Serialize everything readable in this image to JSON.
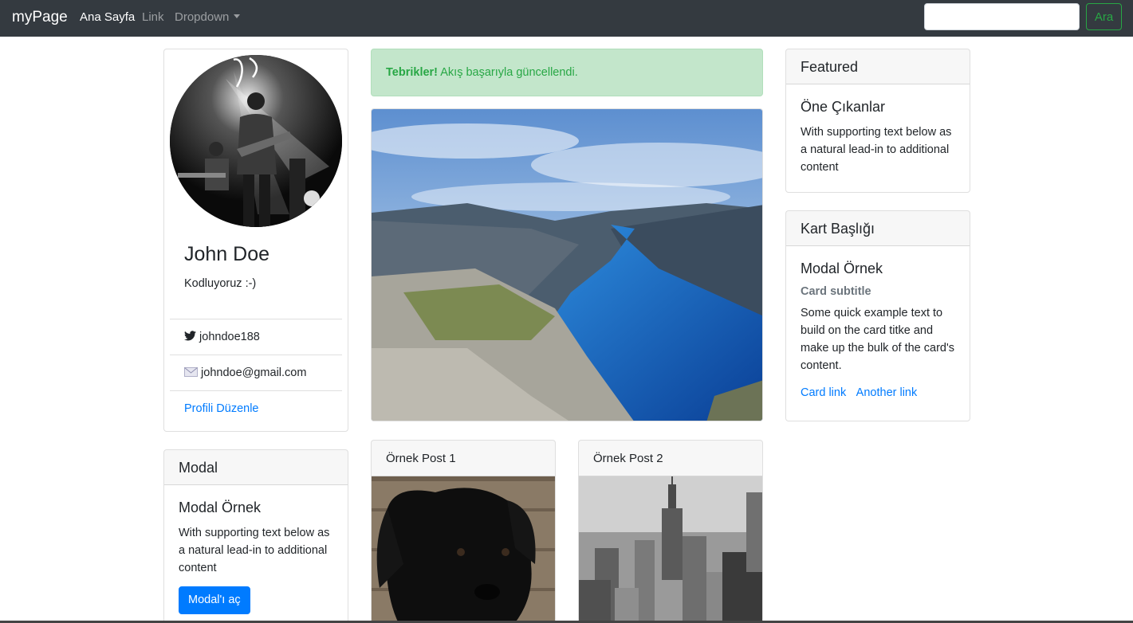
{
  "navbar": {
    "brand": "myPage",
    "links": [
      {
        "label": "Ana Sayfa",
        "active": true
      },
      {
        "label": "Link",
        "active": false
      },
      {
        "label": "Dropdown",
        "active": false
      }
    ],
    "search_placeholder": "",
    "search_button": "Ara"
  },
  "profile": {
    "name": "John Doe",
    "bio": "Kodluyoruz :-)",
    "twitter": "johndoe188",
    "email": "johndoe@gmail.com",
    "edit_link": "Profili Düzenle"
  },
  "modal_card": {
    "header": "Modal",
    "title": "Modal Örnek",
    "text": "With supporting text below as a natural lead-in to additional content",
    "button": "Modal'ı aç"
  },
  "alert": {
    "strong": "Tebrikler!",
    "message": " Akış başarıyla güncellendi."
  },
  "posts": [
    {
      "title": "Örnek Post 1"
    },
    {
      "title": "Örnek Post 2"
    }
  ],
  "featured_card": {
    "header": "Featured",
    "title": "Öne Çıkanlar",
    "text": "With supporting text below as a natural lead-in to additional content"
  },
  "kart_card": {
    "header": "Kart Başlığı",
    "title": "Modal Örnek",
    "subtitle": "Card subtitle",
    "text": "Some quick example text to build on the card titke and make up the bulk of the card's content.",
    "link1": "Card link",
    "link2": "Another link"
  },
  "colors": {
    "navbar": "#343a40",
    "primary": "#007bff",
    "success": "#28a745",
    "alert_bg": "#c3e6cb"
  }
}
